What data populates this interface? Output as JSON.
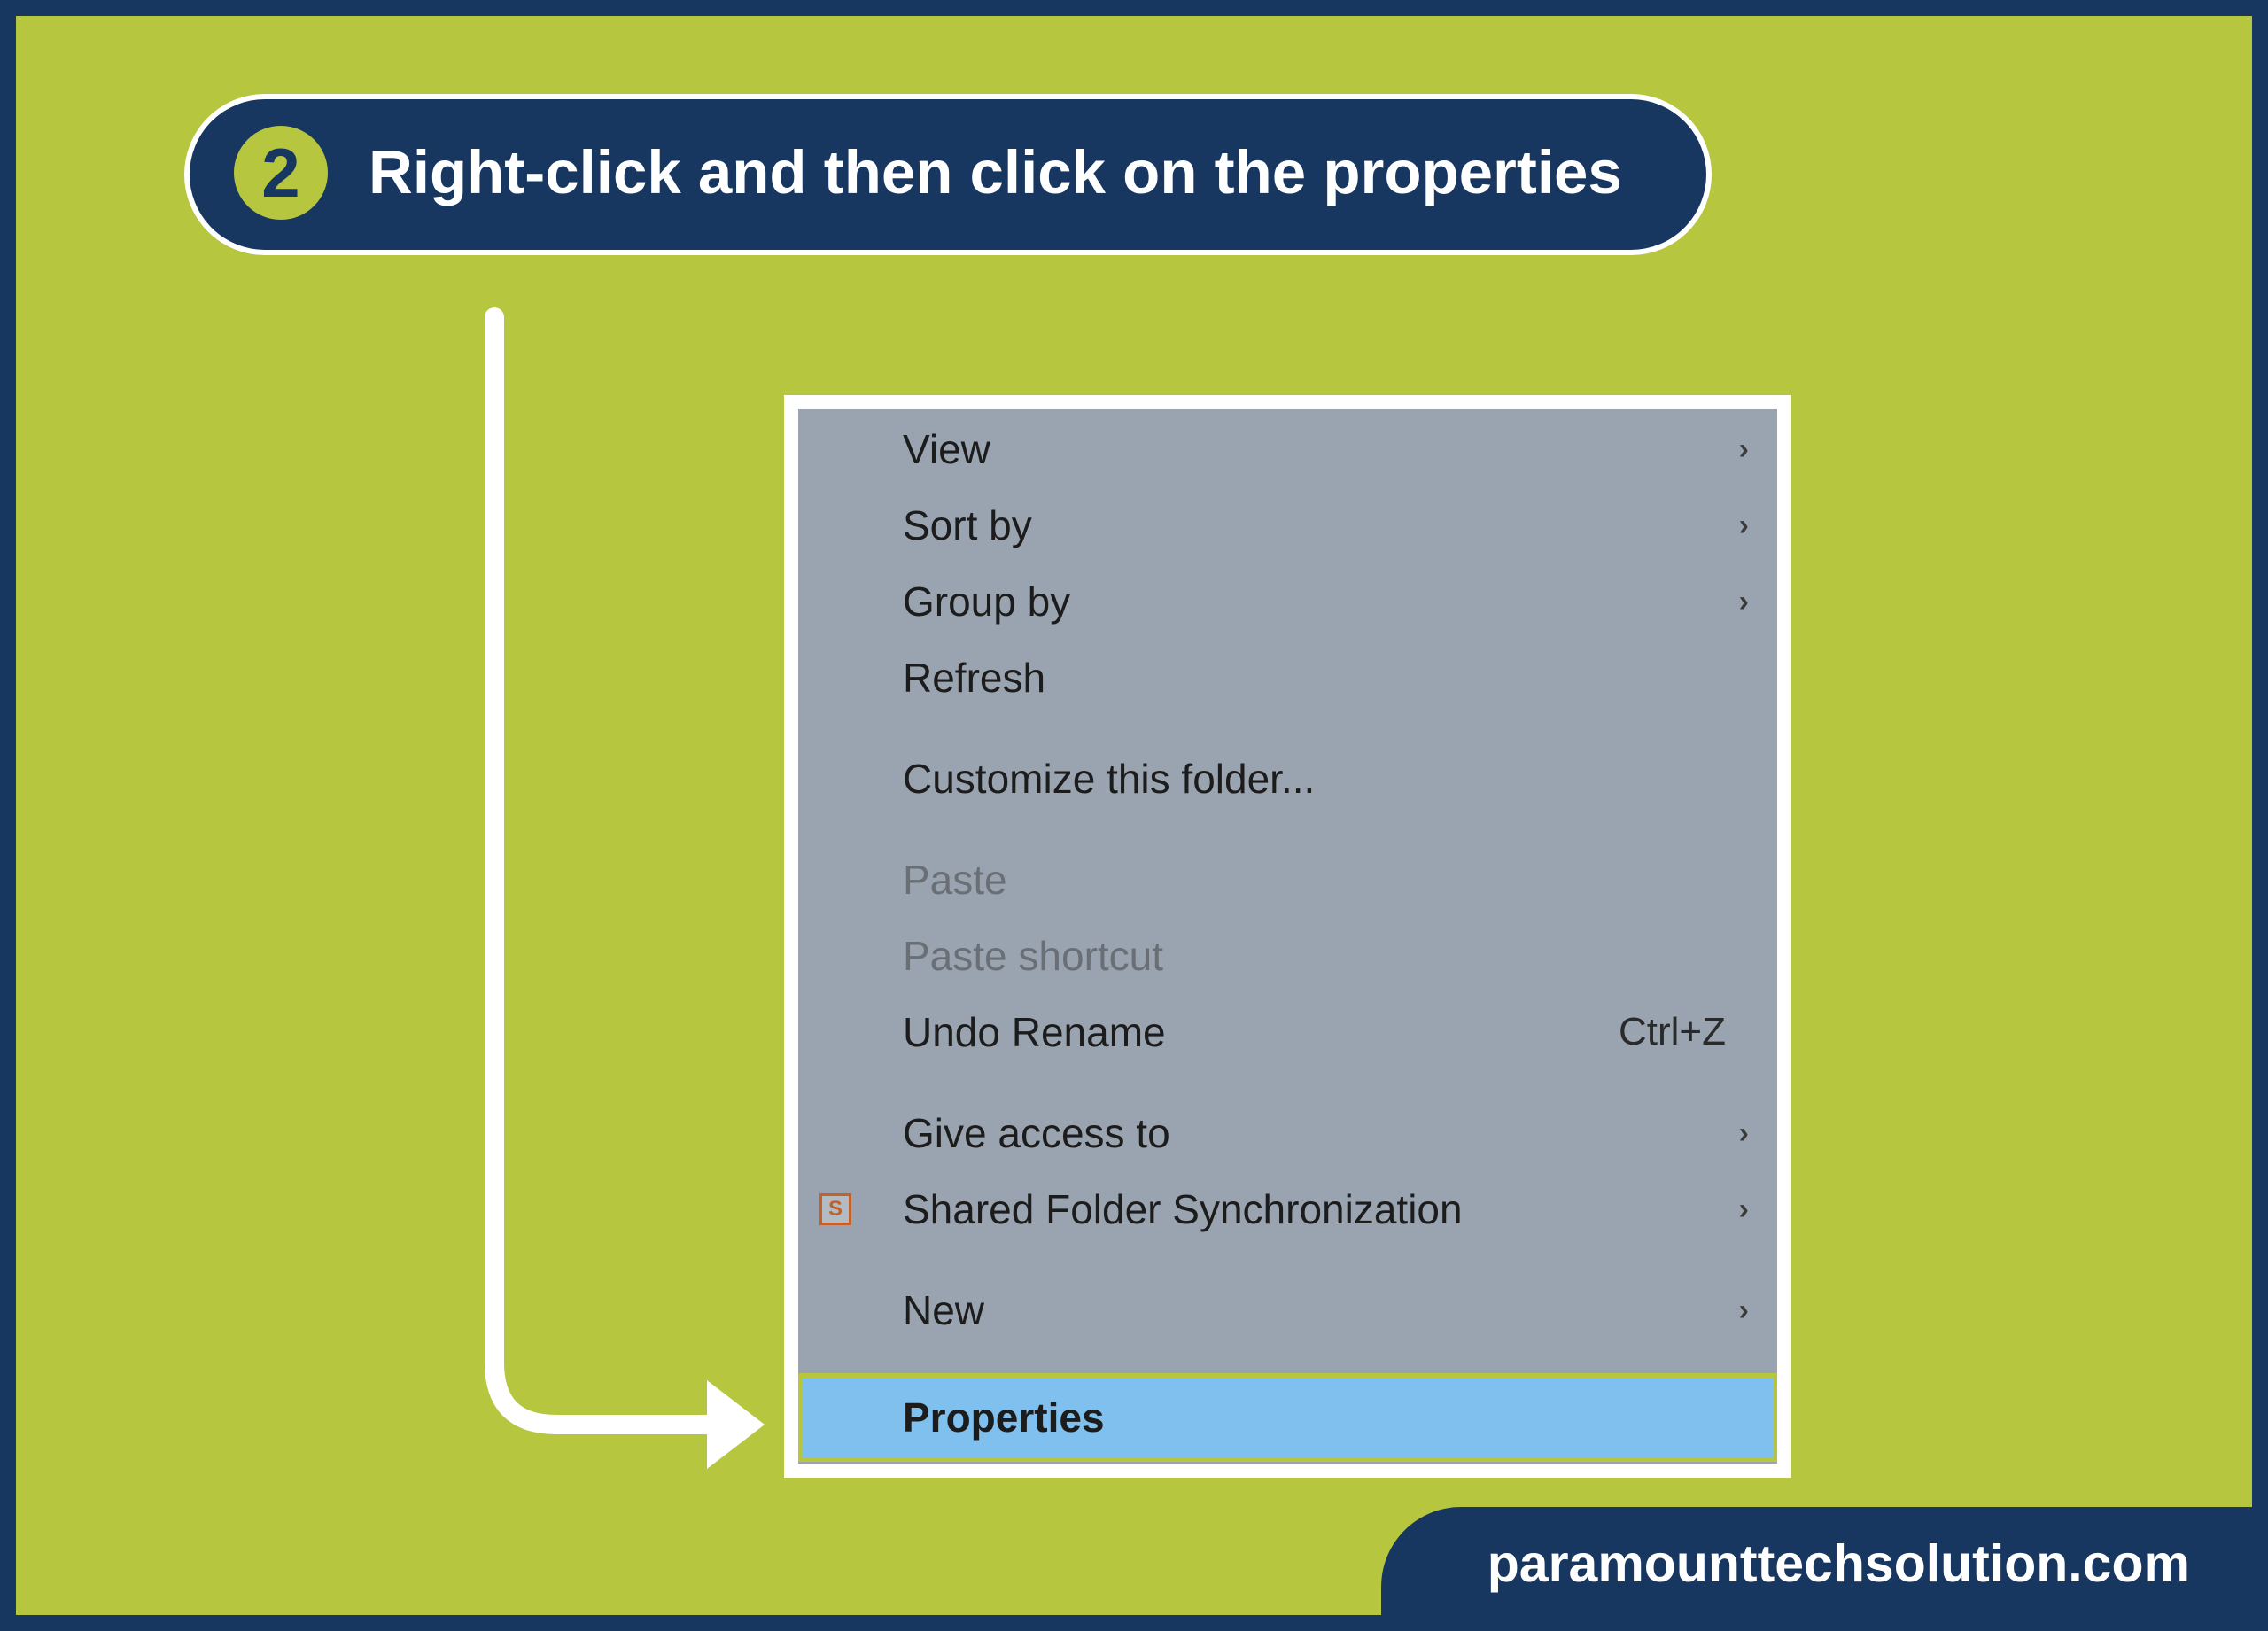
{
  "step": {
    "number": "2",
    "text": "Right-click and then click on the properties"
  },
  "context_menu": {
    "items": [
      {
        "label": "View",
        "submenu": true
      },
      {
        "label": "Sort by",
        "submenu": true
      },
      {
        "label": "Group by",
        "submenu": true
      },
      {
        "label": "Refresh"
      },
      {
        "separator": true
      },
      {
        "label": "Customize this folder..."
      },
      {
        "separator": true
      },
      {
        "label": "Paste",
        "disabled": true
      },
      {
        "label": "Paste shortcut",
        "disabled": true
      },
      {
        "label": "Undo Rename",
        "shortcut": "Ctrl+Z"
      },
      {
        "separator": true
      },
      {
        "label": "Give access to",
        "submenu": true
      },
      {
        "label": "Shared Folder Synchronization",
        "submenu": true,
        "icon": "sfs"
      },
      {
        "separator": true
      },
      {
        "label": "New",
        "submenu": true
      },
      {
        "separator": true
      },
      {
        "label": "Properties",
        "highlighted": true
      }
    ]
  },
  "footer": {
    "label": "paramounttechsolution.com"
  },
  "icons": {
    "sfs_letter": "S"
  }
}
